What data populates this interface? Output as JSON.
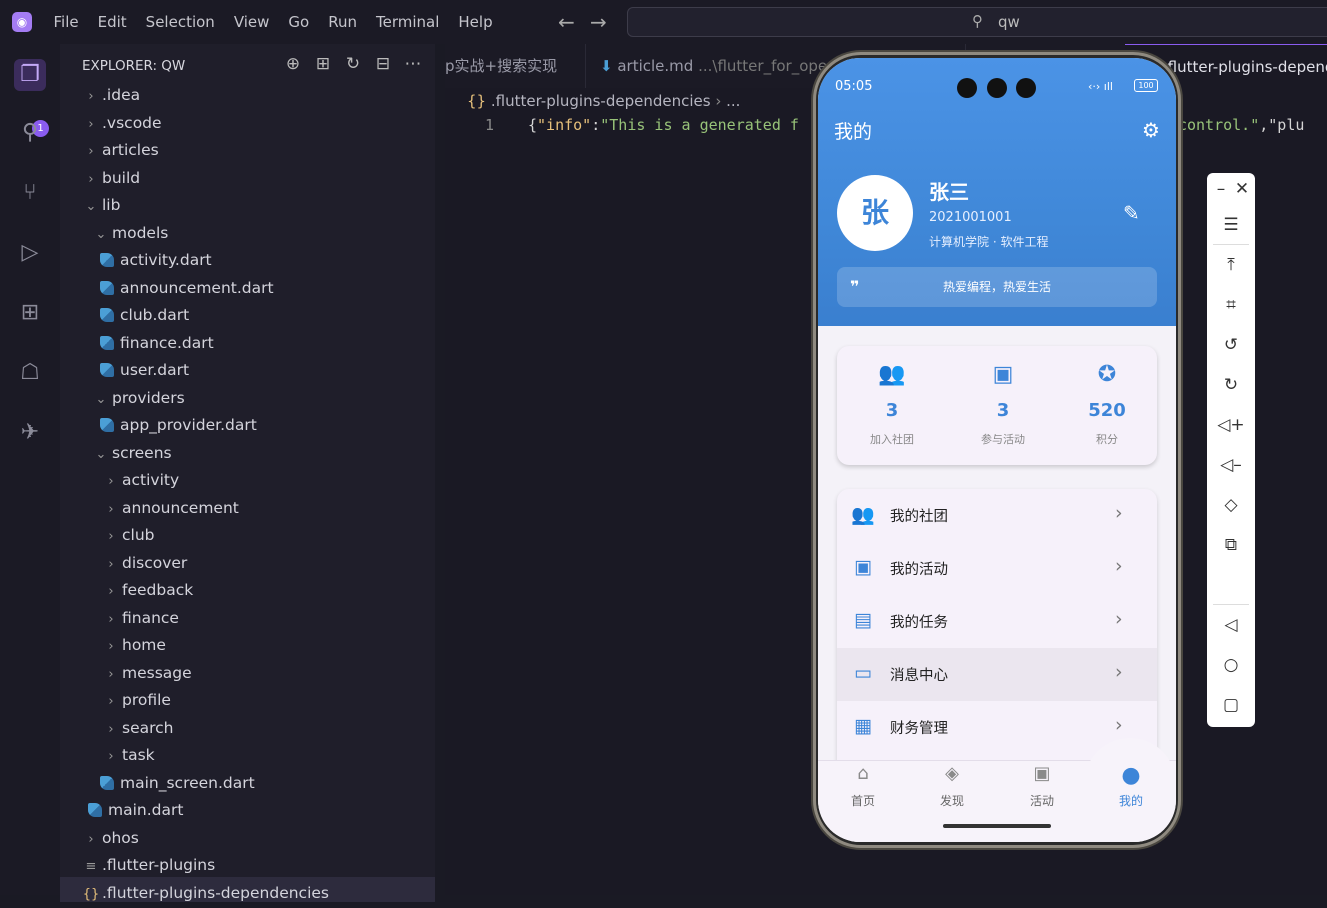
{
  "menubar": {
    "items": [
      "File",
      "Edit",
      "Selection",
      "View",
      "Go",
      "Run",
      "Terminal",
      "Help"
    ]
  },
  "command_center": {
    "text": "qw"
  },
  "activity_bar": {
    "badge": "1"
  },
  "explorer": {
    "title": "EXPLORER: QW",
    "tree": [
      {
        "label": ".idea",
        "kind": "folder",
        "open": false,
        "depth": 0
      },
      {
        "label": ".vscode",
        "kind": "folder",
        "open": false,
        "depth": 0
      },
      {
        "label": "articles",
        "kind": "folder",
        "open": false,
        "depth": 0
      },
      {
        "label": "build",
        "kind": "folder",
        "open": false,
        "depth": 0
      },
      {
        "label": "lib",
        "kind": "folder",
        "open": true,
        "depth": 0
      },
      {
        "label": "models",
        "kind": "folder",
        "open": true,
        "depth": 1
      },
      {
        "label": "activity.dart",
        "kind": "dart",
        "depth": 2
      },
      {
        "label": "announcement.dart",
        "kind": "dart",
        "depth": 2
      },
      {
        "label": "club.dart",
        "kind": "dart",
        "depth": 2
      },
      {
        "label": "finance.dart",
        "kind": "dart",
        "depth": 2
      },
      {
        "label": "user.dart",
        "kind": "dart",
        "depth": 2
      },
      {
        "label": "providers",
        "kind": "folder",
        "open": true,
        "depth": 1
      },
      {
        "label": "app_provider.dart",
        "kind": "dart",
        "depth": 2
      },
      {
        "label": "screens",
        "kind": "folder",
        "open": true,
        "depth": 1
      },
      {
        "label": "activity",
        "kind": "folder",
        "open": false,
        "depth": 2
      },
      {
        "label": "announcement",
        "kind": "folder",
        "open": false,
        "depth": 2
      },
      {
        "label": "club",
        "kind": "folder",
        "open": false,
        "depth": 2
      },
      {
        "label": "discover",
        "kind": "folder",
        "open": false,
        "depth": 2
      },
      {
        "label": "feedback",
        "kind": "folder",
        "open": false,
        "depth": 2
      },
      {
        "label": "finance",
        "kind": "folder",
        "open": false,
        "depth": 2
      },
      {
        "label": "home",
        "kind": "folder",
        "open": false,
        "depth": 2
      },
      {
        "label": "message",
        "kind": "folder",
        "open": false,
        "depth": 2
      },
      {
        "label": "profile",
        "kind": "folder",
        "open": false,
        "depth": 2
      },
      {
        "label": "search",
        "kind": "folder",
        "open": false,
        "depth": 2
      },
      {
        "label": "task",
        "kind": "folder",
        "open": false,
        "depth": 2
      },
      {
        "label": "main_screen.dart",
        "kind": "dart",
        "depth": 2
      },
      {
        "label": "main.dart",
        "kind": "dart",
        "depth": 1
      },
      {
        "label": "ohos",
        "kind": "folder",
        "open": false,
        "depth": 0
      },
      {
        "label": ".flutter-plugins",
        "kind": "text",
        "depth": 0
      },
      {
        "label": ".flutter-plugins-dependencies",
        "kind": "json",
        "depth": 0
      }
    ]
  },
  "tabs": [
    {
      "label": "p实战+搜索实现"
    },
    {
      "label": "article.md",
      "path": "...\\flutter_for_openh"
    },
    {
      "label": ".flutter-plugins-depende"
    }
  ],
  "editor": {
    "breadcrumb": ".flutter-plugins-dependencies",
    "breadcrumb_more": "...",
    "line_number": "1",
    "code_prefix": "{",
    "code_key": "\"info\"",
    "code_colon": ":",
    "code_str_start": "\"This is a generated f",
    "code_str_end": " control.\"",
    "code_tail": ",\"plu"
  },
  "phone": {
    "status": {
      "time": "05:05",
      "battery": "100"
    },
    "page_title": "我的",
    "profile": {
      "avatar_char": "张",
      "name": "张三",
      "student_id": "2021001001",
      "department": "计算机学院 · 软件工程",
      "motto": "热爱编程，热爱生活"
    },
    "stats": [
      {
        "value": "3",
        "label": "加入社团",
        "icon": "group-icon"
      },
      {
        "value": "3",
        "label": "参与活动",
        "icon": "calendar-icon"
      },
      {
        "value": "520",
        "label": "积分",
        "icon": "star-icon"
      }
    ],
    "menu": [
      {
        "label": "我的社团",
        "icon": "group-icon"
      },
      {
        "label": "我的活动",
        "icon": "calendar-icon"
      },
      {
        "label": "我的任务",
        "icon": "clipboard-icon"
      },
      {
        "label": "消息中心",
        "icon": "message-icon"
      },
      {
        "label": "财务管理",
        "icon": "wallet-icon"
      }
    ],
    "bottom_nav": [
      {
        "label": "首页",
        "icon": "home-icon"
      },
      {
        "label": "发现",
        "icon": "compass-icon"
      },
      {
        "label": "活动",
        "icon": "calendar-icon"
      },
      {
        "label": "我的",
        "icon": "person-icon",
        "active": true
      }
    ]
  },
  "colors": {
    "accent": "#8a5cf0",
    "phone_primary": "#3d85d8"
  }
}
